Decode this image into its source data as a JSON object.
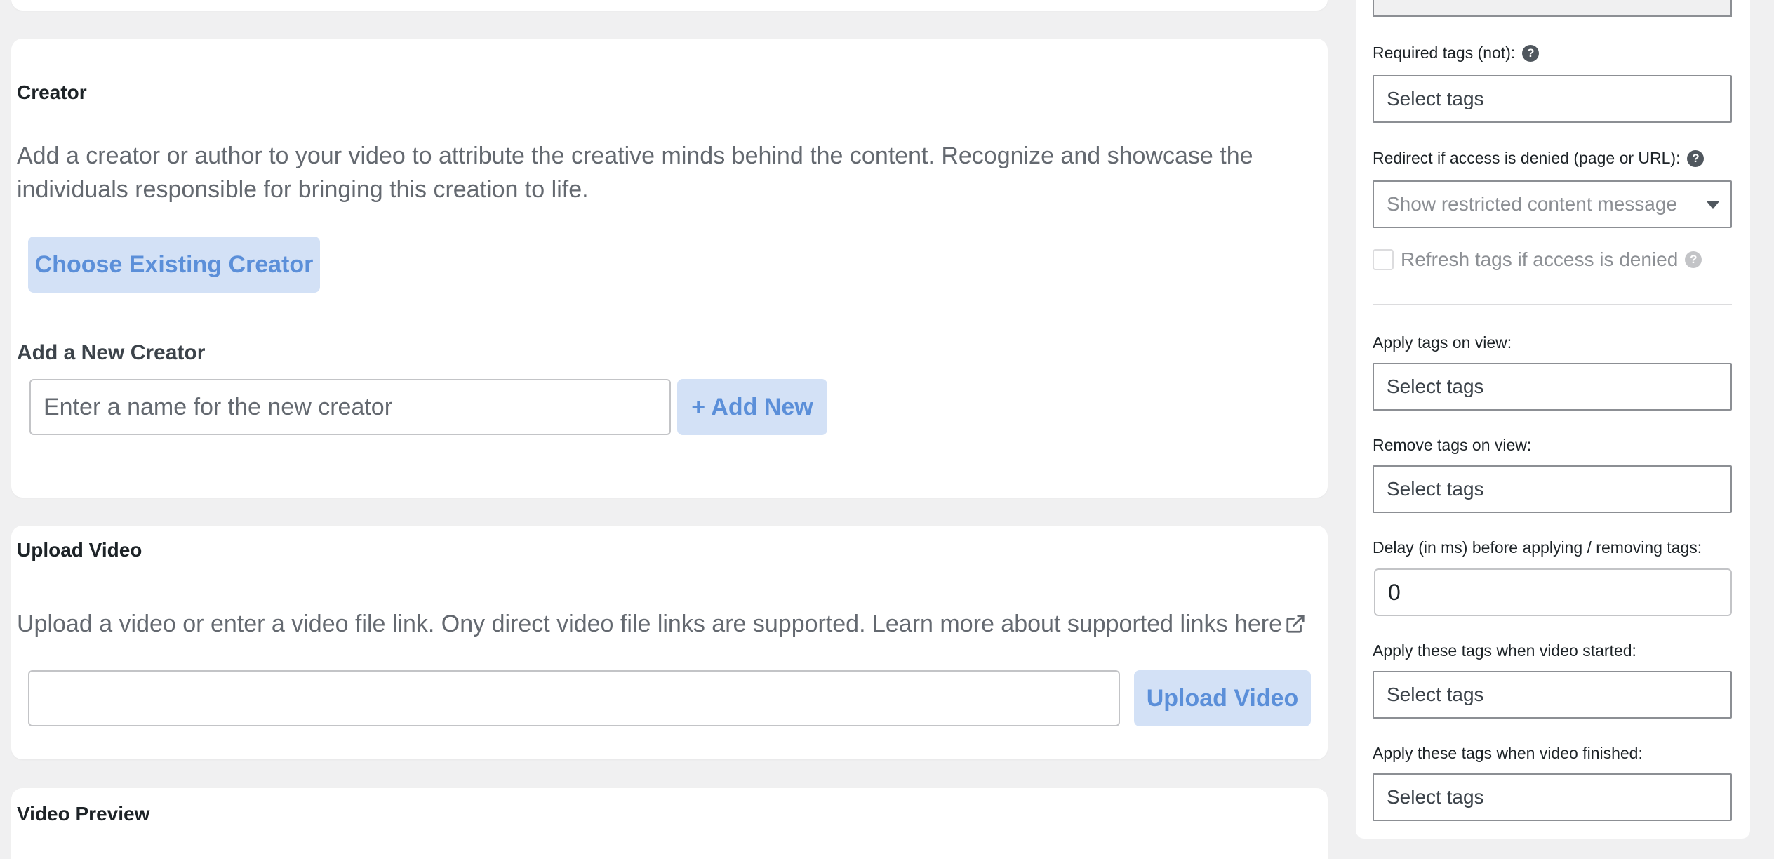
{
  "creator": {
    "title": "Creator",
    "description": "Add a creator or author to your video to attribute the creative minds behind the content. Recognize and showcase the individuals responsible for bringing this creation to life.",
    "choose_button": "Choose Existing Creator",
    "new_heading": "Add a New Creator",
    "new_placeholder": "Enter a name for the new creator",
    "add_button": "+ Add New"
  },
  "upload": {
    "title": "Upload Video",
    "description": "Upload a video or enter a video file link. Ony direct video file links are supported. Learn more about supported links here",
    "link_icon": "external-link-icon",
    "input_value": "",
    "button": "Upload Video"
  },
  "preview": {
    "title": "Video Preview"
  },
  "sidebar": {
    "required_tags_not": {
      "label": "Required tags (not):",
      "placeholder": "Select tags"
    },
    "redirect": {
      "label": "Redirect if access is denied (page or URL):",
      "selected": "Show restricted content message"
    },
    "refresh": {
      "label": "Refresh tags if access is denied",
      "checked": false
    },
    "apply_on_view": {
      "label": "Apply tags on view:",
      "placeholder": "Select tags"
    },
    "remove_on_view": {
      "label": "Remove tags on view:",
      "placeholder": "Select tags"
    },
    "delay": {
      "label": "Delay (in ms) before applying / removing tags:",
      "value": "0"
    },
    "apply_started": {
      "label": "Apply these tags when video started:",
      "placeholder": "Select tags"
    },
    "apply_finished": {
      "label": "Apply these tags when video finished:",
      "placeholder": "Select tags"
    },
    "help_glyph": "?"
  },
  "colors": {
    "background": "#f0f0f1",
    "card": "#ffffff",
    "button_bg": "#d3e1f6",
    "button_text": "#5b8fd9",
    "muted_text": "#646970"
  }
}
